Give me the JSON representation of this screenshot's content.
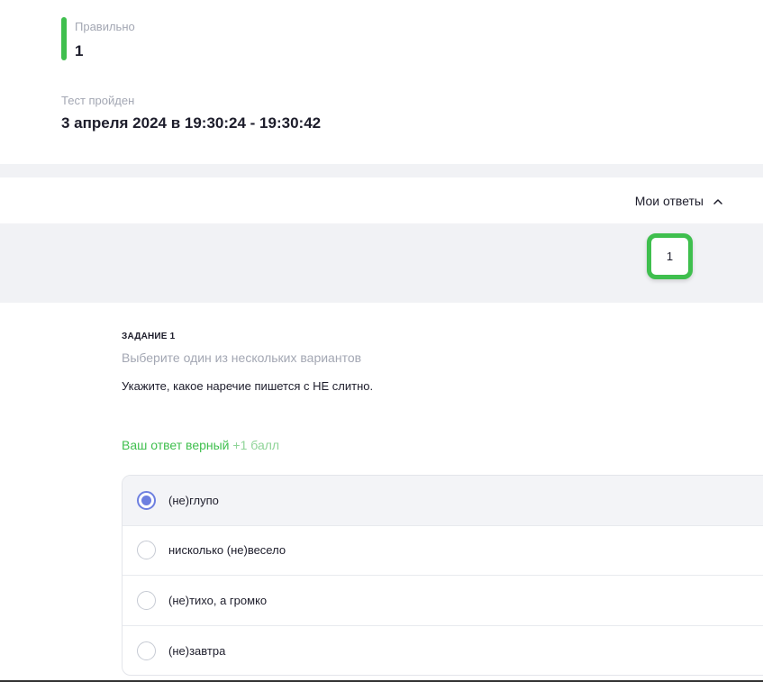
{
  "summary": {
    "correct_label": "Правильно",
    "correct_value": "1",
    "completed_label": "Тест пройден",
    "completed_value": "3 апреля 2024 в 19:30:24 - 19:30:42"
  },
  "answers_toggle": {
    "label": "Мои ответы",
    "icon": "chevron-up-icon"
  },
  "question_nav": [
    {
      "number": "1",
      "status": "correct"
    }
  ],
  "task": {
    "title": "ЗАДАНИЕ 1",
    "subtitle": "Выберите один из нескольких вариантов",
    "question": "Укажите, какое наречие пишется с НЕ слитно.",
    "result_text": "Ваш ответ верный",
    "result_points": "+1 балл",
    "options": [
      {
        "label": "(не)глупо",
        "selected": true
      },
      {
        "label": "нисколько (не)весело",
        "selected": false
      },
      {
        "label": "(не)тихо, а громко",
        "selected": false
      },
      {
        "label": "(не)завтра",
        "selected": false
      }
    ]
  },
  "colors": {
    "accent_green": "#3fbf4e",
    "radio_blue": "#6d7fe0",
    "muted_text": "#a3a7b3",
    "band_gray": "#f1f2f5"
  }
}
